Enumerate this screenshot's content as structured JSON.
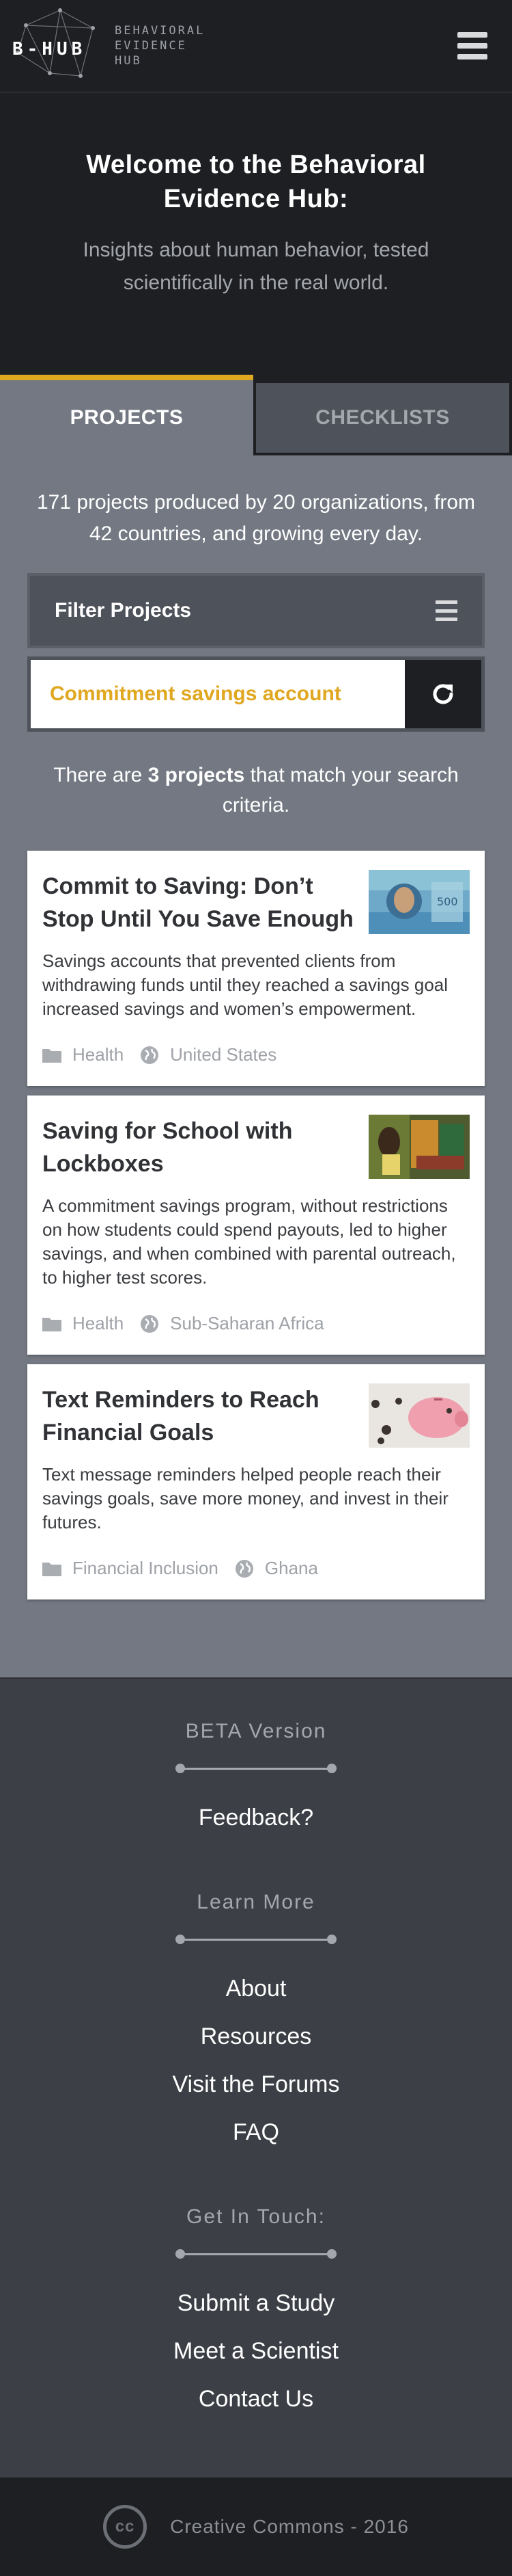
{
  "header": {
    "logo_word": "B-HUB",
    "logo_sub": [
      "BEHAVIORAL",
      "EVIDENCE",
      "HUB"
    ],
    "menu_icon": "hamburger-menu-icon"
  },
  "hero": {
    "title": "Welcome to the Behavioral Evidence Hub:",
    "subtitle": "Insights about human behavior, tested scientifically in the real world."
  },
  "tabs": [
    {
      "label": "PROJECTS",
      "active": true
    },
    {
      "label": "CHECKLISTS",
      "active": false
    }
  ],
  "stats": "171 projects produced by 20 organizations, from 42 countries, and growing every day.",
  "filter": {
    "label": "Filter Projects",
    "icon": "filter-list-icon"
  },
  "search": {
    "value": "Commitment savings account",
    "button_icon": "refresh-icon"
  },
  "results": {
    "prefix": "There are ",
    "count": "3 projects",
    "suffix": " that match your search criteria."
  },
  "projects": [
    {
      "title": "Commit to Saving: Don’t Stop Until You Save Enough",
      "description": "Savings accounts that prevented clients from withdrawing funds until they reached a savings goal increased savings and women’s empowerment.",
      "category": "Health",
      "region": "United States"
    },
    {
      "title": "Saving for School with Lockboxes",
      "description": "A commitment savings program, without restrictions on how students could spend payouts, led to higher savings, and when combined with parental outreach, to higher test scores.",
      "category": "Health",
      "region": "Sub-Saharan Africa"
    },
    {
      "title": "Text Reminders to Reach Financial Goals",
      "description": "Text message reminders helped people reach their savings goals, save more money, and invest in their futures.",
      "category": "Financial Inclusion",
      "region": "Ghana"
    }
  ],
  "footer": {
    "beta_heading": "BETA Version",
    "feedback": "Feedback?",
    "learn_heading": "Learn More",
    "learn_links": [
      "About",
      "Resources",
      "Visit the Forums",
      "FAQ"
    ],
    "touch_heading": "Get In Touch:",
    "touch_links": [
      "Submit a Study",
      "Meet a Scientist",
      "Contact Us"
    ]
  },
  "bottom": {
    "cc_label": "cc",
    "text": "Creative Commons - 2016"
  },
  "colors": {
    "accent": "#e0a720",
    "dark": "#1e1f22",
    "main_bg": "#737882",
    "panel": "#4e525a",
    "footer_bg": "#3c3f45"
  }
}
